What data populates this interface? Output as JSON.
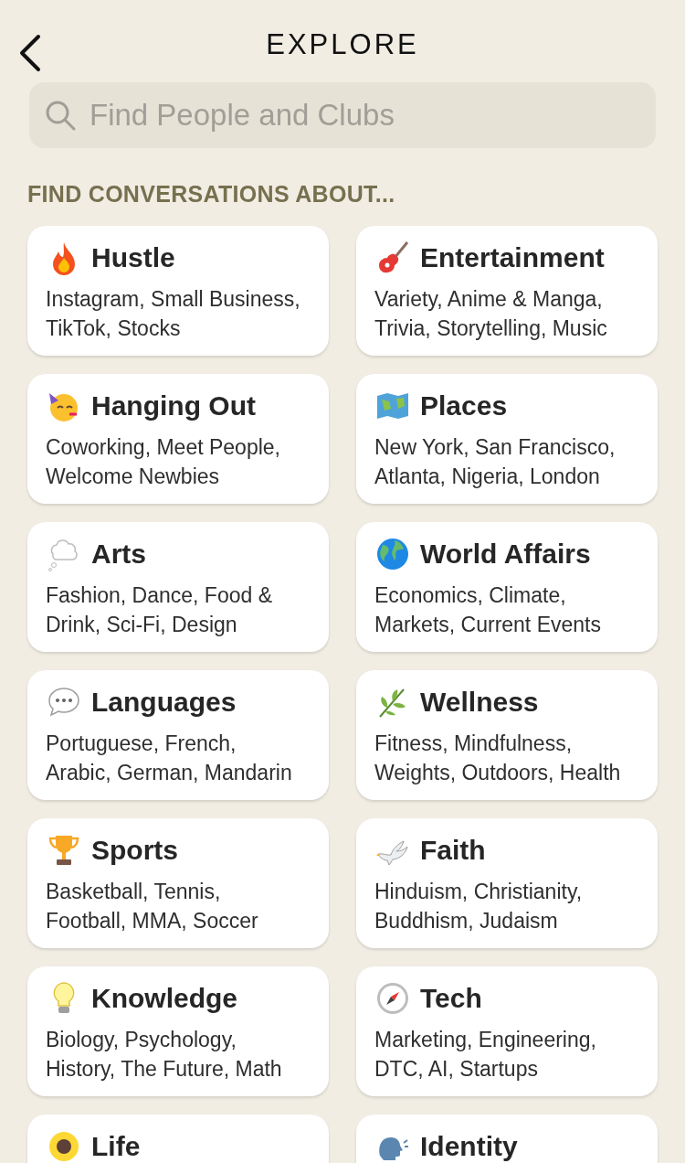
{
  "header": {
    "title": "EXPLORE"
  },
  "search": {
    "placeholder": "Find People and Clubs"
  },
  "section_title": "FIND CONVERSATIONS ABOUT...",
  "topics": [
    {
      "title": "Hustle",
      "subtitle": "Instagram, Small Business, TikTok, Stocks"
    },
    {
      "title": "Entertainment",
      "subtitle": "Variety, Anime & Manga, Trivia, Storytelling, Music"
    },
    {
      "title": "Hanging Out",
      "subtitle": "Coworking, Meet People, Welcome Newbies"
    },
    {
      "title": "Places",
      "subtitle": "New York, San Francisco, Atlanta, Nigeria, London"
    },
    {
      "title": "Arts",
      "subtitle": "Fashion, Dance, Food & Drink, Sci-Fi, Design"
    },
    {
      "title": "World Affairs",
      "subtitle": "Economics, Climate, Markets, Current Events"
    },
    {
      "title": "Languages",
      "subtitle": "Portuguese, French, Arabic, German, Mandarin"
    },
    {
      "title": "Wellness",
      "subtitle": "Fitness, Mindfulness, Weights, Outdoors, Health"
    },
    {
      "title": "Sports",
      "subtitle": "Basketball, Tennis, Football, MMA, Soccer"
    },
    {
      "title": "Faith",
      "subtitle": "Hinduism, Christianity, Buddhism, Judaism"
    },
    {
      "title": "Knowledge",
      "subtitle": "Biology, Psychology, History, The Future, Math"
    },
    {
      "title": "Tech",
      "subtitle": "Marketing, Engineering, DTC, AI, Startups"
    },
    {
      "title": "Life"
    },
    {
      "title": "Identity"
    }
  ]
}
